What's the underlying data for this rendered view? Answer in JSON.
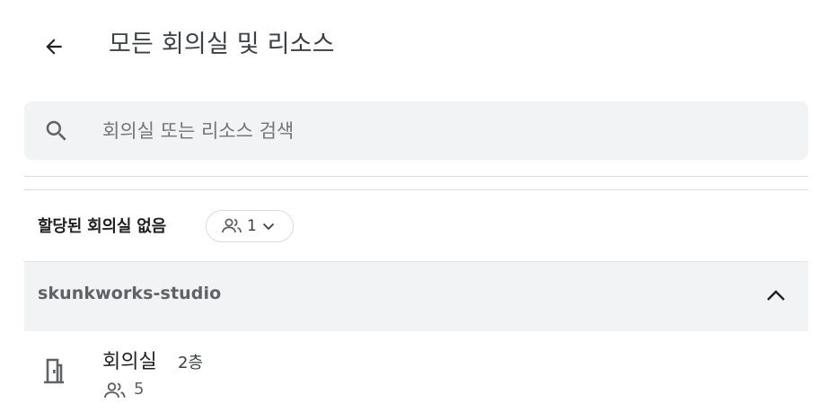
{
  "header": {
    "title": "모든 회의실 및 리소스",
    "back_icon": "arrow-back-icon"
  },
  "search": {
    "placeholder": "회의실 또는 리소스 검색",
    "value": "",
    "icon": "search-icon"
  },
  "filter": {
    "label": "할당된 회의실 없음",
    "capacity_chip": {
      "icon": "people-icon",
      "value": "1",
      "dropdown_icon": "chevron-down-icon"
    }
  },
  "groups": [
    {
      "name": "skunkworks-studio",
      "expanded": true,
      "toggle_icon": "chevron-up-icon",
      "rooms": [
        {
          "name": "회의실",
          "floor": "2층",
          "capacity": "5",
          "icon": "door-icon",
          "capacity_icon": "people-icon"
        }
      ]
    }
  ],
  "colors": {
    "search_bg": "#f1f3f4",
    "group_bg": "#f1f3f4",
    "divider": "#dadce0",
    "text_primary": "#202124",
    "text_secondary": "#5f6368"
  }
}
